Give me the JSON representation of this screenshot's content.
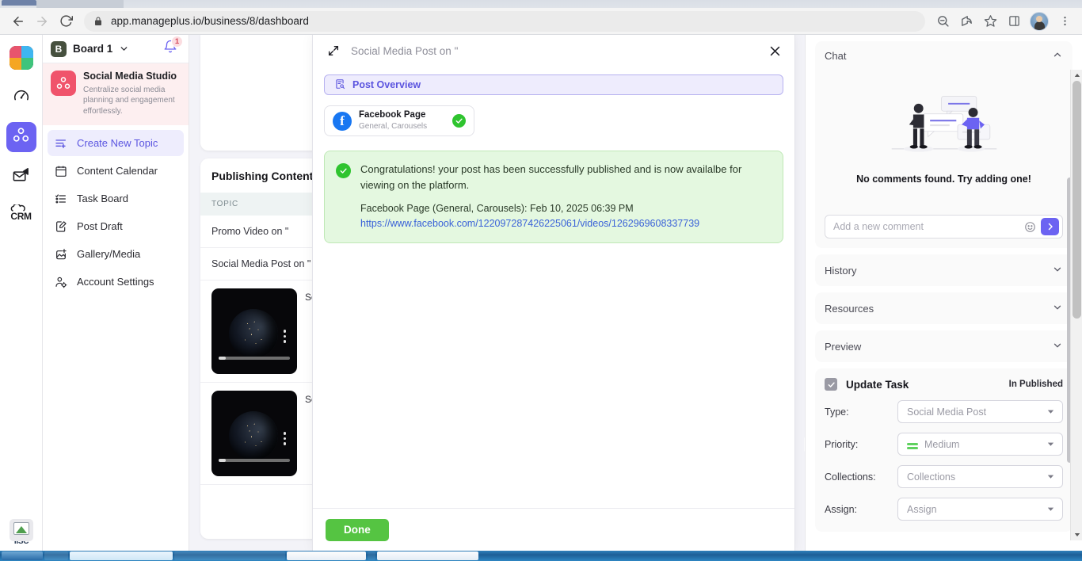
{
  "browser": {
    "url": "app.manageplus.io/business/8/dashboard",
    "back_label": "Back",
    "forward_label": "Forward",
    "reload_label": "Reload",
    "lock_icon": "lock-icon",
    "zoom_icon": "zoom-out-icon",
    "share_icon": "share-icon",
    "bookmark_icon": "star-icon",
    "sidepanel_icon": "side-panel-icon",
    "profile_icon": "profile-avatar",
    "menu_icon": "three-dot-menu-icon"
  },
  "rail": {
    "items": [
      {
        "name": "app-logo",
        "icon": "colorful-plus-logo"
      },
      {
        "name": "dashboard",
        "icon": "speedometer-icon"
      },
      {
        "name": "social-media-studio",
        "icon": "molecule-icon",
        "active": true
      },
      {
        "name": "email-marketing",
        "icon": "envelope-megaphone-icon"
      },
      {
        "name": "crm",
        "icon": "crm-cloud-icon",
        "label": "CRM"
      }
    ],
    "bottom_label": "IISC"
  },
  "sidebar": {
    "board": {
      "initial": "B",
      "name": "Board 1",
      "caret": "chevron-down-icon"
    },
    "notifications": {
      "icon": "bell-icon",
      "count": "1"
    },
    "studio": {
      "icon": "molecule-icon",
      "title": "Social Media Studio",
      "subtitle": "Centralize social media planning and engagement effortlessly."
    },
    "items": [
      {
        "label": "Create New Topic",
        "icon": "create-topic-icon",
        "active": true
      },
      {
        "label": "Content Calendar",
        "icon": "calendar-icon",
        "active": false
      },
      {
        "label": "Task Board",
        "icon": "task-list-icon",
        "active": false
      },
      {
        "label": "Post Draft",
        "icon": "draft-edit-icon",
        "active": false
      },
      {
        "label": "Gallery/Media",
        "icon": "gallery-add-icon",
        "active": false
      },
      {
        "label": "Account Settings",
        "icon": "account-settings-icon",
        "active": false
      }
    ]
  },
  "publishing": {
    "title": "Publishing Content",
    "column_header": "TOPIC",
    "rows": [
      {
        "topic": "Promo Video on \""
      },
      {
        "topic": "Social Media Post on \""
      }
    ],
    "media_rows": [
      {
        "label": "Soc",
        "thumb_alt": "earth-at-night-video-thumbnail"
      },
      {
        "label": "Soc",
        "thumb_alt": "earth-at-night-video-thumbnail"
      }
    ]
  },
  "modal": {
    "expand_icon": "expand-arrows-icon",
    "title": "Social Media Post on \"",
    "close_icon": "close-icon",
    "tab": {
      "label": "Post Overview",
      "icon": "document-search-icon"
    },
    "account": {
      "name": "Facebook Page",
      "subtitle": "General, Carousels",
      "platform_icon": "facebook-icon",
      "status_icon": "check-circle-icon"
    },
    "success": {
      "icon": "check-circle-icon",
      "message": "Congratulations! your post has been successfully published and is now availalbe for viewing on the platform.",
      "meta": "Facebook Page (General, Carousels): Feb 10, 2025 06:39 PM",
      "link": "https://www.facebook.com/122097287426225061/videos/1262969608337739"
    },
    "done_label": "Done"
  },
  "right_panel": {
    "chat": {
      "title": "Chat",
      "collapse_icon": "chevron-up-icon",
      "empty_text": "No comments found. Try adding one!",
      "input_placeholder": "Add a new comment",
      "input_value": "",
      "emoji_icon": "emoji-smiley-icon",
      "send_icon": "send-arrow-icon"
    },
    "sections": [
      {
        "label": "History",
        "icon": "chevron-down-icon"
      },
      {
        "label": "Resources",
        "icon": "chevron-down-icon"
      },
      {
        "label": "Preview",
        "icon": "chevron-down-icon"
      }
    ],
    "task": {
      "checkbox_icon": "checkbox-checked-icon",
      "title": "Update Task",
      "status": "In Published",
      "fields": [
        {
          "label": "Type:",
          "value": "Social Media Post",
          "icon": "",
          "caret": "caret-down-icon"
        },
        {
          "label": "Priority:",
          "value": "Medium",
          "icon": "priority-medium-icon",
          "caret": "caret-down-icon"
        },
        {
          "label": "Collections:",
          "value": "Collections",
          "icon": "",
          "caret": "caret-down-icon"
        },
        {
          "label": "Assign:",
          "value": "Assign",
          "icon": "",
          "caret": "caret-down-icon"
        }
      ]
    }
  },
  "colors": {
    "accent_purple": "#6c63f2",
    "success_green": "#2fc42f",
    "done_green": "#55c442",
    "studio_pink": "#f0536b",
    "facebook_blue": "#1877f2",
    "link_blue": "#3a62d8"
  }
}
